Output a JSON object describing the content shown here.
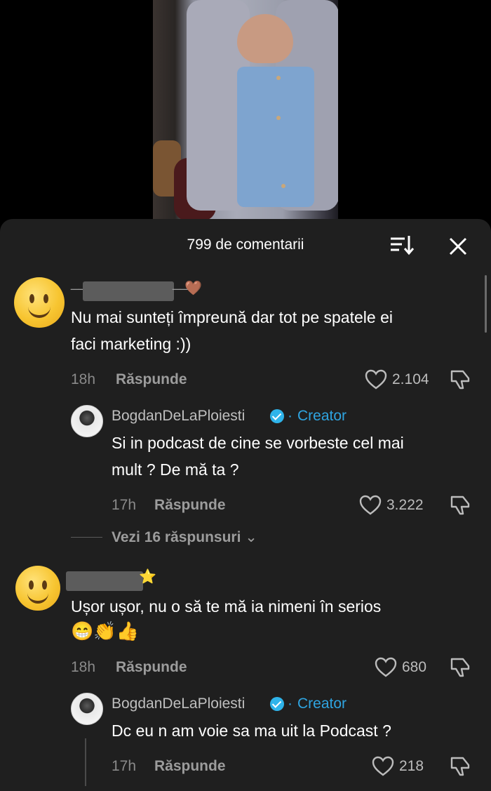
{
  "video": {
    "description_icon": "video-frame"
  },
  "header": {
    "title": "799 de comentarii",
    "sort_icon": "sort-icon",
    "close_icon": "close-icon"
  },
  "comments": [
    {
      "avatar": "smiley-emoji-avatar",
      "username_prefix": "__",
      "username_suffix": "__",
      "badge_emoji": "🤎",
      "text_line1": "Nu mai sunteți împreună dar tot pe spatele ei",
      "text_line2": "faci marketing :))",
      "time": "18h",
      "reply_label": "Răspunde",
      "likes": "2.104",
      "reply": {
        "username": "BogdanDeLaPloiesti",
        "separator": "·",
        "tag": "Creator",
        "text_line1": "Si in podcast de cine se vorbeste cel mai",
        "text_line2": "mult ? De mă ta ?",
        "time": "17h",
        "reply_label": "Răspunde",
        "likes": "3.222"
      },
      "view_replies": "Vezi 16 răspunsuri"
    },
    {
      "avatar": "smiley-emoji-avatar",
      "badge_emoji": "⭐",
      "text_line1": "Ușor ușor, nu o să te mă ia nimeni în serios",
      "text_emojis": [
        "😁",
        "👏",
        "👍"
      ],
      "time": "18h",
      "reply_label": "Răspunde",
      "likes": "680",
      "reply": {
        "username": "BogdanDeLaPloiesti",
        "separator": "·",
        "tag": "Creator",
        "text_line1": "Dc eu n am voie sa ma uit la Podcast ?",
        "time": "17h",
        "reply_label": "Răspunde",
        "likes": "218"
      }
    }
  ]
}
